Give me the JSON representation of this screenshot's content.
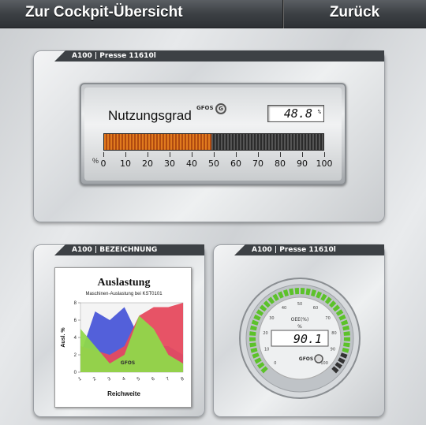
{
  "topbar": {
    "overview_label": "Zur Cockpit-Übersicht",
    "back_label": "Zurück"
  },
  "panel1": {
    "tab": "A100 | Presse 11610l",
    "label": "Nutzungsgrad",
    "logo": "GFOS",
    "value": "48.8",
    "unit": "%",
    "fill_percent": 48.8,
    "scale_unit": "%",
    "scale": [
      "0",
      "10",
      "20",
      "30",
      "40",
      "50",
      "60",
      "70",
      "80",
      "90",
      "100"
    ]
  },
  "panel2": {
    "tab": "A100 | BEZEICHNUNG"
  },
  "panel3": {
    "tab": "A100 | Presse 11610l",
    "gauge_label": "OEE(%)",
    "value": "90.1",
    "unit": "%",
    "logo": "GFOS",
    "gauge_percent": 90.1,
    "ticks": [
      "0",
      "10",
      "20",
      "30",
      "40",
      "50",
      "60",
      "70",
      "80",
      "90",
      "100"
    ]
  },
  "chart_data": {
    "type": "area",
    "title": "Auslastung",
    "subtitle": "Maschinen-Auslastung bei KST0101",
    "xlabel": "Reichweite",
    "ylabel": "Ausl. %",
    "watermark": "GFOS",
    "categories": [
      "1",
      "2",
      "3",
      "4",
      "5",
      "6",
      "7",
      "8"
    ],
    "yticks": [
      "0",
      "2",
      "4",
      "6",
      "8"
    ],
    "ylim": [
      0,
      8
    ],
    "series": [
      {
        "color": "#4a57d8",
        "values": [
          2,
          7,
          6,
          7.5,
          4,
          3,
          3,
          2
        ]
      },
      {
        "color": "#e64a5e",
        "values": [
          3,
          2.5,
          2,
          3,
          6.5,
          7.5,
          7.5,
          8
        ]
      },
      {
        "color": "#8fd84a",
        "values": [
          5,
          3,
          1,
          2,
          6.5,
          5,
          2,
          1
        ]
      }
    ]
  }
}
